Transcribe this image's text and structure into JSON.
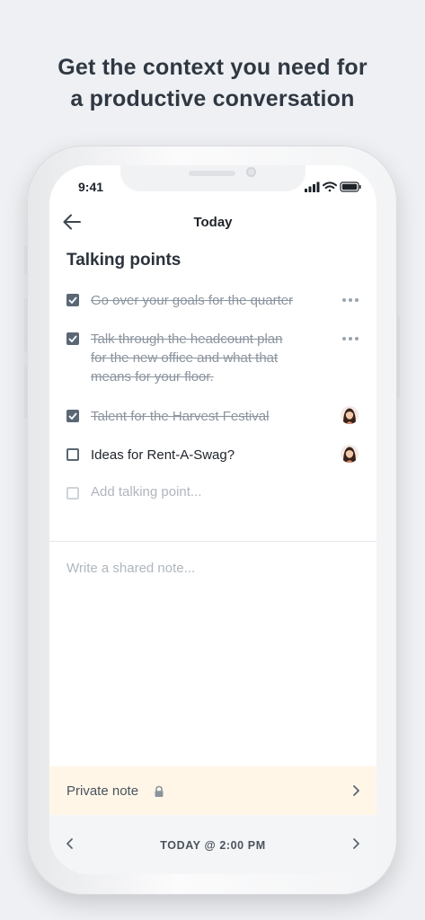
{
  "headline": {
    "line1": "Get the context you need for",
    "line2": "a productive conversation"
  },
  "status_bar": {
    "time": "9:41",
    "icons": [
      "signal-icon",
      "wifi-icon",
      "battery-icon"
    ]
  },
  "nav": {
    "title": "Today",
    "back_icon": "arrow-left-icon"
  },
  "talking_points": {
    "title": "Talking points",
    "items": [
      {
        "text_lines": [
          "Go over your goals for the quarter"
        ],
        "checked": true,
        "trailing": "more"
      },
      {
        "text_lines": [
          "Talk through the headcount plan",
          "for the new office and what that",
          "means for your floor."
        ],
        "checked": true,
        "trailing": "more"
      },
      {
        "text_lines": [
          "Talent for the Harvest Festival"
        ],
        "checked": true,
        "trailing": "avatar"
      },
      {
        "text_lines": [
          "Ideas for Rent-A-Swag?"
        ],
        "checked": false,
        "trailing": "avatar"
      }
    ],
    "add_placeholder": "Add talking point..."
  },
  "shared_note": {
    "placeholder": "Write a shared note..."
  },
  "private_note": {
    "label": "Private note",
    "icon": "lock-icon"
  },
  "footer": {
    "date_label": "TODAY @ 2:00 PM"
  },
  "colors": {
    "accent_check": "#5b6774",
    "private_bg": "#fff6e8",
    "background": "#eef0f3"
  }
}
